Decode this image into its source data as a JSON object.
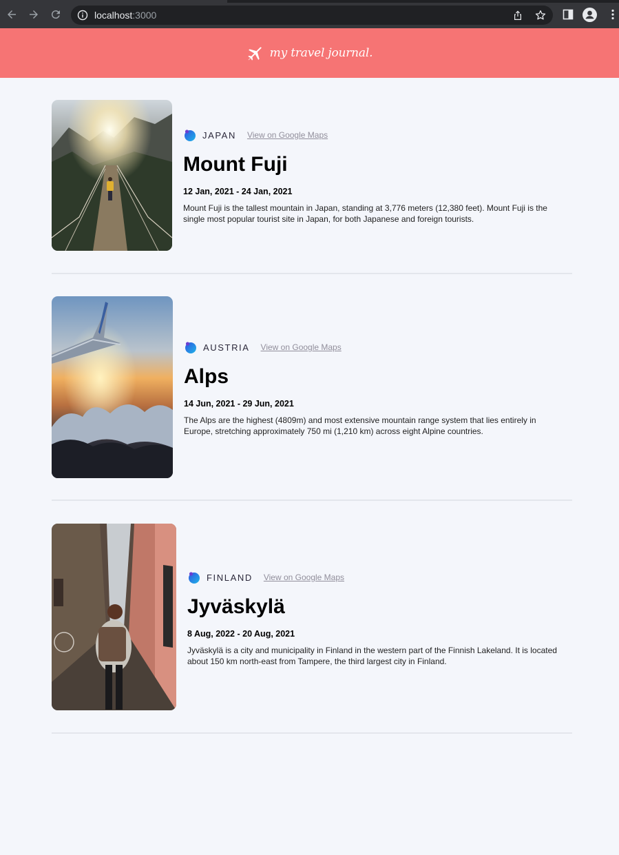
{
  "browser": {
    "url_host": "localhost",
    "url_port": ":3000"
  },
  "header": {
    "brand": "my travel journal."
  },
  "entries": [
    {
      "country": "JAPAN",
      "maps_link": "View on Google Maps",
      "title": "Mount Fuji",
      "dates": "12 Jan, 2021 - 24 Jan, 2021",
      "description": "Mount Fuji is the tallest mountain in Japan, standing at 3,776 meters (12,380 feet). Mount Fuji is the single most popular tourist site in Japan, for both Japanese and foreign tourists."
    },
    {
      "country": "AUSTRIA",
      "maps_link": "View on Google Maps",
      "title": "Alps",
      "dates": "14 Jun, 2021 - 29 Jun, 2021",
      "description": "The Alps are the highest (4809m) and most extensive mountain range system that lies entirely in Europe, stretching approximately 750 mi (1,210 km) across eight Alpine countries."
    },
    {
      "country": "FINLAND",
      "maps_link": "View on Google Maps",
      "title": "Jyväskylä",
      "dates": "8 Aug, 2022 - 20 Aug, 2021",
      "description": "Jyväskylä is a city and municipality in Finland in the western part of the Finnish Lakeland. It is located about 150 km north-east from Tampere, the third largest city in Finland."
    }
  ],
  "colors": {
    "header_bg": "#f67474",
    "page_bg": "#f4f6fb",
    "link": "#918e9b"
  },
  "icons": [
    "back-arrow-icon",
    "forward-arrow-icon",
    "reload-icon",
    "info-icon",
    "share-icon",
    "star-icon",
    "side-panel-icon",
    "profile-icon",
    "menu-dots-icon",
    "globe-pin-icon"
  ]
}
